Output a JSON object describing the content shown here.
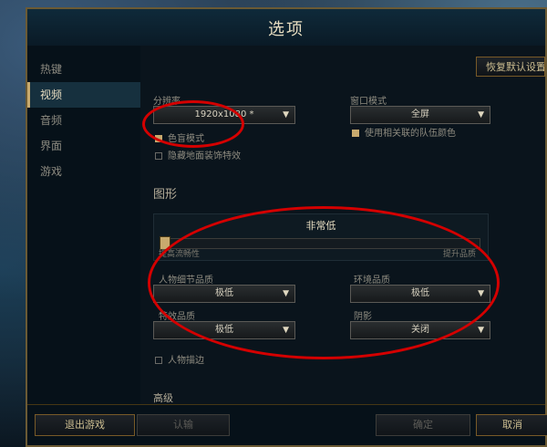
{
  "window": {
    "title": "选项"
  },
  "sidebar": {
    "items": [
      {
        "label": "热键"
      },
      {
        "label": "视频"
      },
      {
        "label": "音频"
      },
      {
        "label": "界面"
      },
      {
        "label": "游戏"
      }
    ],
    "active_index": 1
  },
  "video": {
    "restore_label": "恢复默认设置",
    "resolution": {
      "label": "分辨率",
      "value": "1920x1080 *"
    },
    "window_mode": {
      "label": "窗口模式",
      "value": "全屏"
    },
    "colorblind_label": "色盲模式",
    "colorblind_checked": true,
    "hide_eye_candy_label": "隐藏地面装饰特效",
    "hide_eye_candy_checked": false,
    "team_colors_label": "使用相关联的队伍颜色",
    "team_colors_checked": true
  },
  "graphics": {
    "title": "图形",
    "quality_value": "非常低",
    "slider_min_label": "提高流畅性",
    "slider_max_label": "提升品质",
    "slider_position": 0.0,
    "character_quality": {
      "label": "人物细节品质",
      "value": "极低"
    },
    "environment_quality": {
      "label": "环境品质",
      "value": "极低"
    },
    "effects_quality": {
      "label": "特效品质",
      "value": "极低"
    },
    "shadows": {
      "label": "阴影",
      "value": "关闭"
    },
    "character_inking_label": "人物描边",
    "character_inking_checked": false,
    "advanced_title": "高级"
  },
  "footer": {
    "exit_label": "退出游戏",
    "surrender_label": "认输",
    "ok_label": "确定",
    "cancel_label": "取消"
  },
  "colors": {
    "annotation": "#d40000",
    "gold": "#c8aa6e"
  }
}
